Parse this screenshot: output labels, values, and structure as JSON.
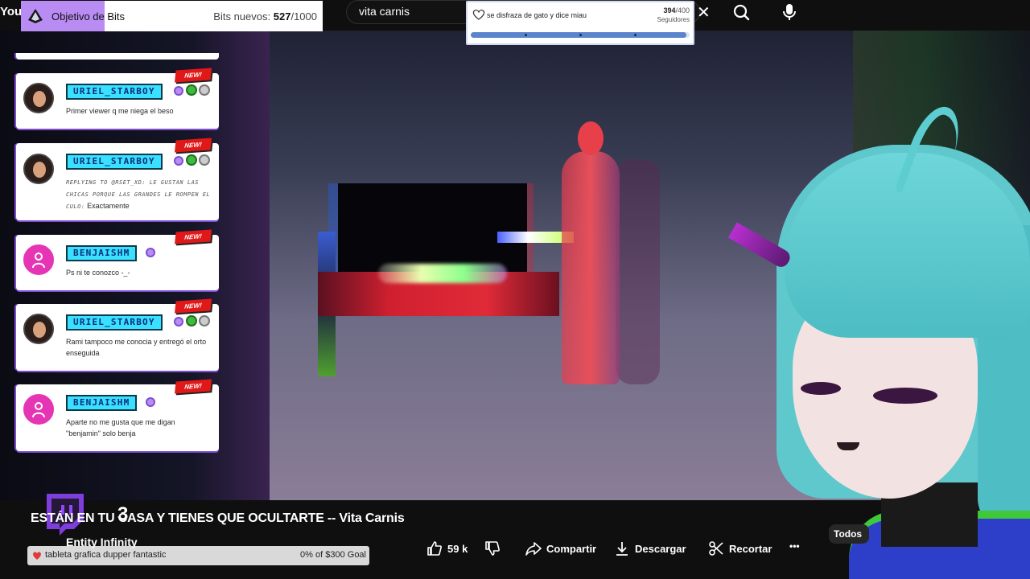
{
  "topbar": {
    "logo_text": "You",
    "search_query": "vita carnis"
  },
  "bits_goal": {
    "label": "Objetivo de Bits",
    "prefix": "Bits nuevos:",
    "current": "527",
    "target": "/1000",
    "progress": 0.527,
    "fill_color": "#b88cf2"
  },
  "followers_goal": {
    "label": "se disfraza de gato y dice miau",
    "current": "394",
    "target": "/400",
    "subtitle": "Seguidores",
    "progress": 0.985,
    "fill_color": "#5a84cc"
  },
  "chat": {
    "messages": [
      {
        "username": "URIEL_STARBOY",
        "avatar": "photo",
        "new_tag": "NEW!",
        "reply_prefix": "",
        "text": "Primer viewer q me niega el beso"
      },
      {
        "username": "URIEL_STARBOY",
        "avatar": "photo",
        "new_tag": "NEW!",
        "reply_prefix": "REPLYING TO @RSET_XD: LE GUSTAN LAS CHICAS PORQUE LAS GRANDES LE ROMPEN EL CULO:",
        "text": "Exactamente"
      },
      {
        "username": "BENJAISHM",
        "avatar": "generic",
        "new_tag": "NEW!",
        "reply_prefix": "",
        "text": "Ps ni te conozco -_-"
      },
      {
        "username": "URIEL_STARBOY",
        "avatar": "photo",
        "new_tag": "NEW!",
        "reply_prefix": "",
        "text": "Rami tampoco me conocia y entregó el orto enseguida"
      },
      {
        "username": "BENJAISHM",
        "avatar": "generic",
        "new_tag": "NEW!",
        "reply_prefix": "",
        "text": "Aparte no me gusta que me digan \"benjamin\" solo benja"
      }
    ]
  },
  "video": {
    "title": "ESTÁN EN TU CASA Y TIENES QUE OCULTARTE -- Vita Carnis",
    "channel": "Entity Infinity",
    "counter": "3"
  },
  "actions": {
    "likes": "59 k",
    "share": "Compartir",
    "download": "Descargar",
    "clip": "Recortar",
    "more": "•••",
    "filter_chip": "Todos"
  },
  "donation_goal": {
    "label": "tableta grafica dupper fantastic",
    "goal": "0% of $300 Goal",
    "progress": 0.0
  },
  "colors": {
    "twitch_purple": "#9146ff",
    "name_badge": "#39e0ff",
    "new_tag": "#e01818",
    "avatar_generic": "#e635b4"
  }
}
